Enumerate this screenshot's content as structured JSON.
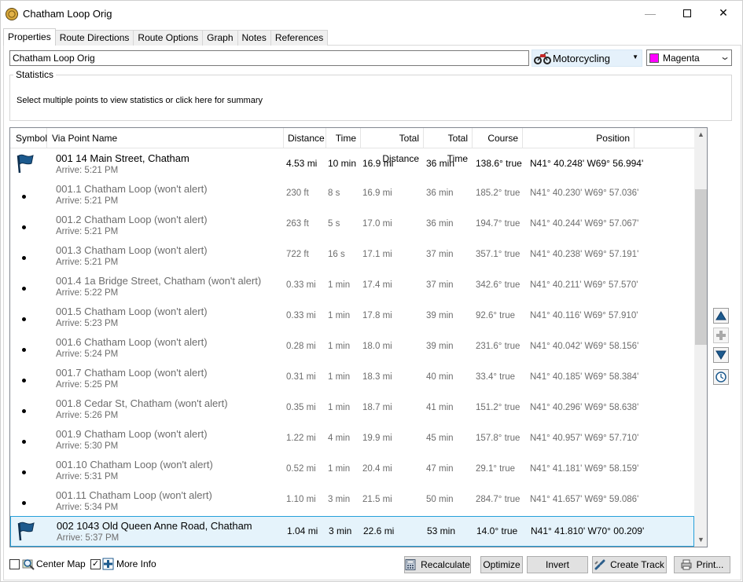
{
  "window": {
    "title": "Chatham Loop Orig"
  },
  "tabs": [
    "Properties",
    "Route Directions",
    "Route Options",
    "Graph",
    "Notes",
    "References"
  ],
  "route_name": "Chatham Loop Orig",
  "mode": {
    "selected": "Motorcycling"
  },
  "color": {
    "selected": "Magenta",
    "swatch": "#ff00ff"
  },
  "statistics": {
    "legend": "Statistics",
    "text": "Select multiple points to view statistics or click here for summary"
  },
  "columns": {
    "symbol": "Symbol",
    "name": "Via Point Name",
    "distance": "Distance",
    "time": "Time",
    "total_distance": "Total Distance",
    "total_time": "Total Time",
    "course": "Course",
    "position": "Position"
  },
  "rows": [
    {
      "symbol": "flag",
      "name": "001  14 Main Street, Chatham",
      "arrive": "Arrive: 5:21 PM",
      "distance": "4.53 mi",
      "time": "10 min",
      "total_distance": "16.9 mi",
      "total_time": "36 min",
      "course": "138.6° true",
      "position": "N41° 40.248' W69° 56.994'"
    },
    {
      "symbol": "dot",
      "name": "001.1 Chatham Loop (won't alert)",
      "arrive": "Arrive: 5:21 PM",
      "distance": "230 ft",
      "time": "8 s",
      "total_distance": "16.9 mi",
      "total_time": "36 min",
      "course": "185.2° true",
      "position": "N41° 40.230' W69° 57.036'"
    },
    {
      "symbol": "dot",
      "name": "001.2 Chatham Loop (won't alert)",
      "arrive": "Arrive: 5:21 PM",
      "distance": "263 ft",
      "time": "5 s",
      "total_distance": "17.0 mi",
      "total_time": "36 min",
      "course": "194.7° true",
      "position": "N41° 40.244' W69° 57.067'"
    },
    {
      "symbol": "dot",
      "name": "001.3 Chatham Loop (won't alert)",
      "arrive": "Arrive: 5:21 PM",
      "distance": "722 ft",
      "time": "16 s",
      "total_distance": "17.1 mi",
      "total_time": "37 min",
      "course": "357.1° true",
      "position": "N41° 40.238' W69° 57.191'"
    },
    {
      "symbol": "dot",
      "name": "001.4  1a Bridge Street, Chatham (won't alert)",
      "arrive": "Arrive: 5:22 PM",
      "distance": "0.33 mi",
      "time": "1 min",
      "total_distance": "17.4 mi",
      "total_time": "37 min",
      "course": "342.6° true",
      "position": "N41° 40.211' W69° 57.570'"
    },
    {
      "symbol": "dot",
      "name": "001.5 Chatham Loop (won't alert)",
      "arrive": "Arrive: 5:23 PM",
      "distance": "0.33 mi",
      "time": "1 min",
      "total_distance": "17.8 mi",
      "total_time": "39 min",
      "course": "92.6° true",
      "position": "N41° 40.116' W69° 57.910'"
    },
    {
      "symbol": "dot",
      "name": "001.6 Chatham Loop (won't alert)",
      "arrive": "Arrive: 5:24 PM",
      "distance": "0.28 mi",
      "time": "1 min",
      "total_distance": "18.0 mi",
      "total_time": "39 min",
      "course": "231.6° true",
      "position": "N41° 40.042' W69° 58.156'"
    },
    {
      "symbol": "dot",
      "name": "001.7 Chatham Loop (won't alert)",
      "arrive": "Arrive: 5:25 PM",
      "distance": "0.31 mi",
      "time": "1 min",
      "total_distance": "18.3 mi",
      "total_time": "40 min",
      "course": "33.4° true",
      "position": "N41° 40.185' W69° 58.384'"
    },
    {
      "symbol": "dot",
      "name": "001.8  Cedar St, Chatham (won't alert)",
      "arrive": "Arrive: 5:26 PM",
      "distance": "0.35 mi",
      "time": "1 min",
      "total_distance": "18.7 mi",
      "total_time": "41 min",
      "course": "151.2° true",
      "position": "N41° 40.296' W69° 58.638'"
    },
    {
      "symbol": "dot",
      "name": "001.9 Chatham Loop (won't alert)",
      "arrive": "Arrive: 5:30 PM",
      "distance": "1.22 mi",
      "time": "4 min",
      "total_distance": "19.9 mi",
      "total_time": "45 min",
      "course": "157.8° true",
      "position": "N41° 40.957' W69° 57.710'"
    },
    {
      "symbol": "dot",
      "name": "001.10 Chatham Loop (won't alert)",
      "arrive": "Arrive: 5:31 PM",
      "distance": "0.52 mi",
      "time": "1 min",
      "total_distance": "20.4 mi",
      "total_time": "47 min",
      "course": "29.1° true",
      "position": "N41° 41.181' W69° 58.159'"
    },
    {
      "symbol": "dot",
      "name": "001.11 Chatham Loop (won't alert)",
      "arrive": "Arrive: 5:34 PM",
      "distance": "1.10 mi",
      "time": "3 min",
      "total_distance": "21.5 mi",
      "total_time": "50 min",
      "course": "284.7° true",
      "position": "N41° 41.657' W69° 59.086'"
    },
    {
      "symbol": "flag",
      "name": "002  1043 Old Queen Anne Road, Chatham",
      "arrive": "Arrive: 5:37 PM",
      "distance": "1.04 mi",
      "time": "3 min",
      "total_distance": "22.6 mi",
      "total_time": "53 min",
      "course": "14.0° true",
      "position": "N41° 41.810' W70° 00.209'",
      "selected": true
    }
  ],
  "bottom": {
    "center_map": "Center Map",
    "center_map_checked": false,
    "more_info": "More Info",
    "more_info_checked": true,
    "recalculate": "Recalculate",
    "optimize": "Optimize",
    "invert": "Invert",
    "create_track": "Create Track",
    "print": "Print..."
  },
  "icons": {
    "flag": "blue-flag-icon",
    "dot": "via-point-dot-icon",
    "move_up": "move-up-icon",
    "add": "add-icon",
    "move_down": "move-down-icon",
    "clock": "clock-icon"
  }
}
